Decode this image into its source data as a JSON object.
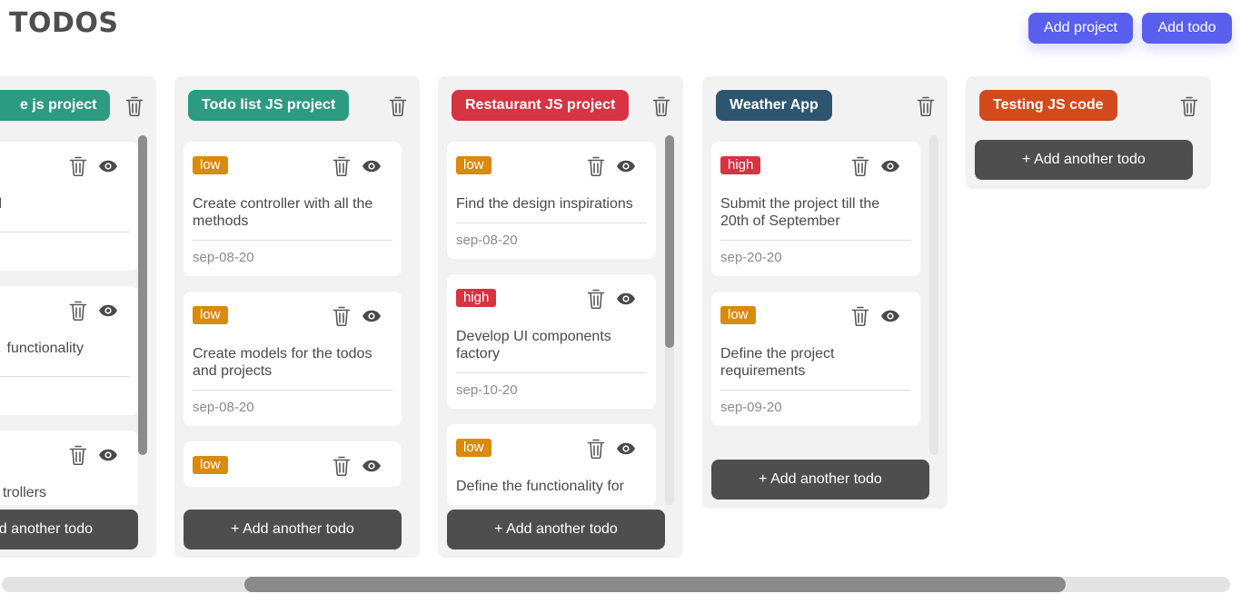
{
  "app": {
    "title": "TODOS"
  },
  "header": {
    "add_project_label": "Add project",
    "add_todo_label": "Add todo"
  },
  "colors": {
    "accent": "#5a5ff0",
    "priority_low": "#d98a0f",
    "priority_high": "#d63343",
    "column_bg": "#f2f2f2",
    "add_button_bg": "#4e4e4e"
  },
  "add_another_label": "+ Add another todo",
  "projects": [
    {
      "name": "e js project",
      "color": "#2d9a82",
      "todos": [
        {
          "priority": "",
          "title": "neboard",
          "date": ""
        },
        {
          "priority": "",
          "title": "functionality",
          "date": ""
        },
        {
          "priority": "",
          "title": "trollers",
          "date": ""
        }
      ],
      "add_label_partial": "d another todo"
    },
    {
      "name": "Todo list JS project",
      "color": "#2d9a82",
      "todos": [
        {
          "priority": "low",
          "title": "Create controller with all the methods",
          "date": "sep-08-20"
        },
        {
          "priority": "low",
          "title": "Create models for the todos and projects",
          "date": "sep-08-20"
        },
        {
          "priority": "low",
          "title": "",
          "date": ""
        }
      ]
    },
    {
      "name": "Restaurant JS project",
      "color": "#d63343",
      "todos": [
        {
          "priority": "low",
          "title": "Find the design inspirations",
          "date": "sep-08-20"
        },
        {
          "priority": "high",
          "title": "Develop UI components factory",
          "date": "sep-10-20"
        },
        {
          "priority": "low",
          "title": "Define the functionality for",
          "date": ""
        }
      ]
    },
    {
      "name": "Weather App",
      "color": "#2e5570",
      "todos": [
        {
          "priority": "high",
          "title": "Submit the project till the 20th of September",
          "date": "sep-20-20"
        },
        {
          "priority": "low",
          "title": "Define the project requirements",
          "date": "sep-09-20"
        }
      ]
    },
    {
      "name": "Testing JS code",
      "color": "#d34a1c",
      "todos": []
    }
  ]
}
